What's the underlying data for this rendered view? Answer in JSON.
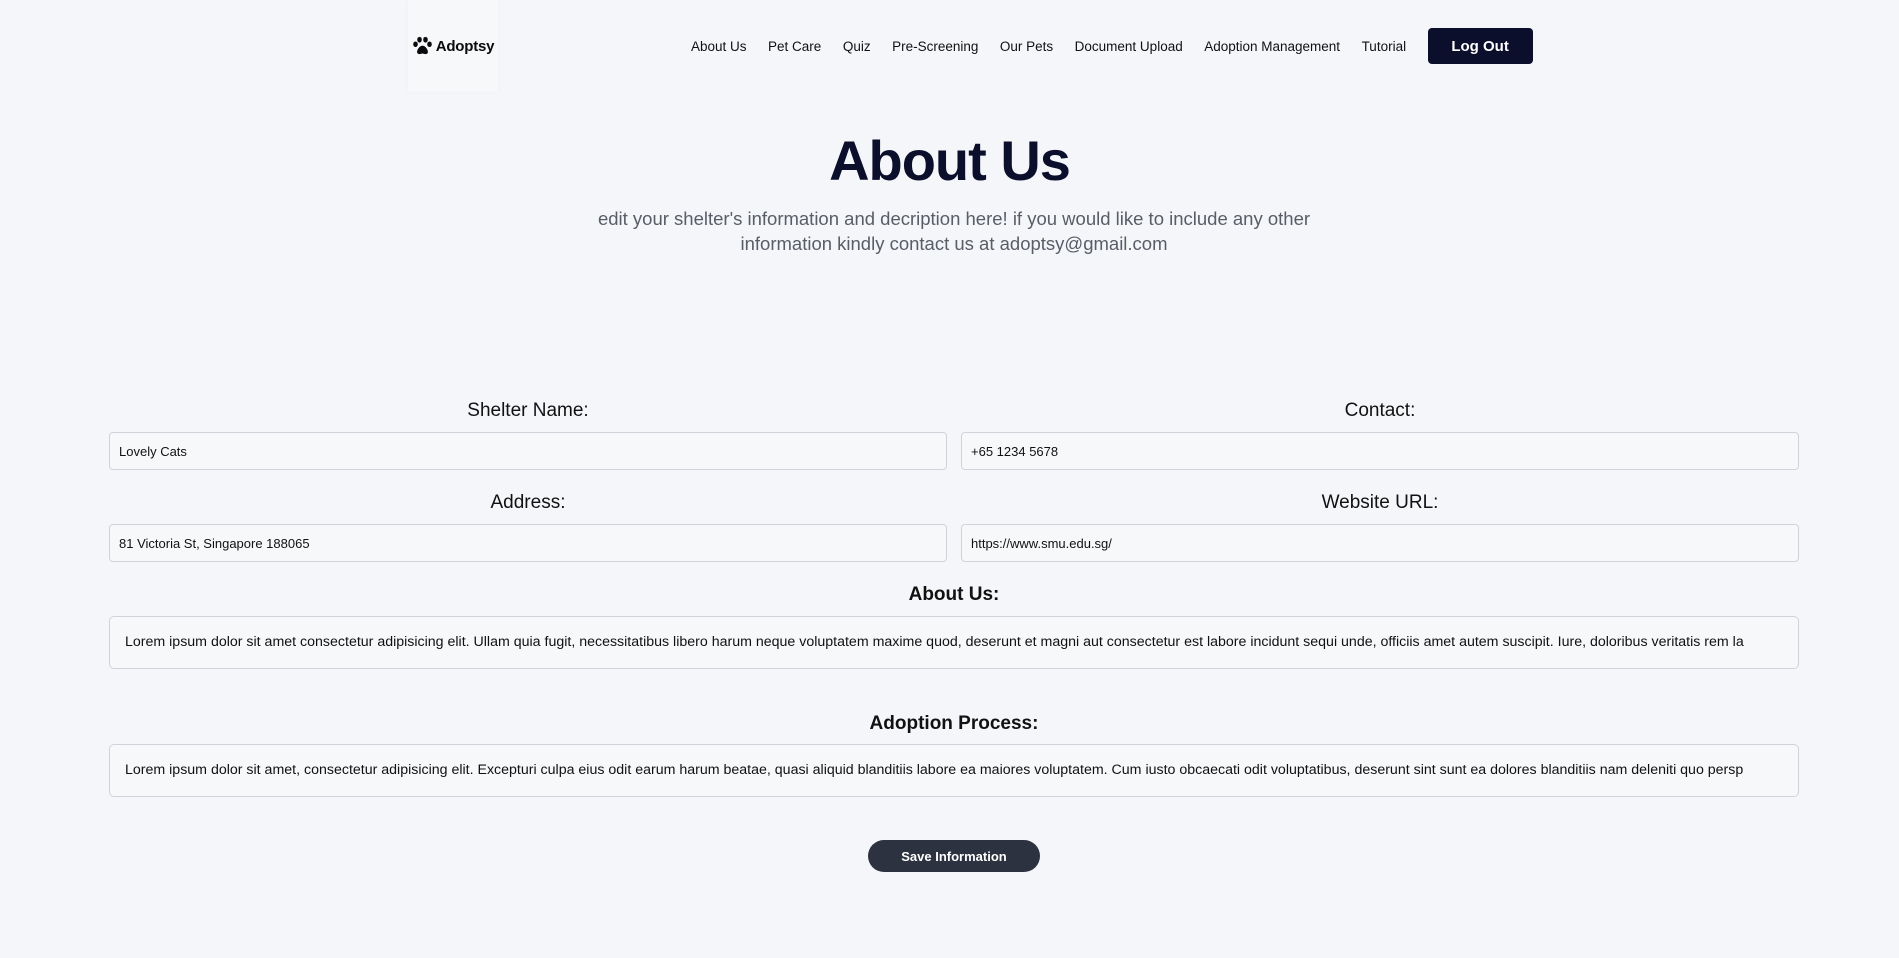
{
  "nav": {
    "brand": "Adoptsy",
    "brand_icon": "paw-icon",
    "links": [
      "About Us",
      "Pet Care",
      "Quiz",
      "Pre-Screening",
      "Our Pets",
      "Document Upload",
      "Adoption Management",
      "Tutorial"
    ],
    "logout_label": "Log Out"
  },
  "hero": {
    "title": "About Us",
    "subtitle": "edit your shelter's information and decription here! if you would like to include any other information kindly contact us at adoptsy@gmail.com"
  },
  "form": {
    "shelter_name": {
      "label": "Shelter Name:",
      "value": "Lovely Cats"
    },
    "contact": {
      "label": "Contact:",
      "value": "+65 1234 5678"
    },
    "address": {
      "label": "Address:",
      "value": "81 Victoria St, Singapore 188065"
    },
    "website": {
      "label": "Website URL:",
      "value": "https://www.smu.edu.sg/"
    },
    "about": {
      "label": "About Us:",
      "value": "Lorem ipsum dolor sit amet consectetur adipisicing elit. Ullam quia fugit, necessitatibus libero harum neque voluptatem maxime quod, deserunt et magni aut consectetur est labore incidunt sequi unde, officiis amet autem suscipit. Iure, doloribus veritatis rem la"
    },
    "process": {
      "label": "Adoption Process:",
      "value": "Lorem ipsum dolor sit amet, consectetur adipisicing elit. Excepturi culpa eius odit earum harum beatae, quasi aliquid blanditiis labore ea maiores voluptatem. Cum iusto obcaecati odit voluptatibus, deserunt sint sunt ea dolores blanditiis nam deleniti quo persp"
    },
    "save_label": "Save Information"
  },
  "colors": {
    "background": "#f4f6f9",
    "navy": "#0c0f2b",
    "save_button": "#2c3240",
    "subtitle_text": "#595d66"
  }
}
